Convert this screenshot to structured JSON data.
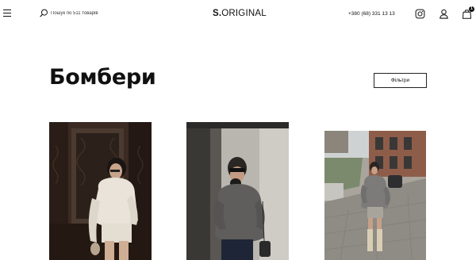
{
  "header": {
    "search": {
      "placeholder": "Пошук по 511 товарів"
    },
    "logo": {
      "bold": "S.",
      "rest": "ORIGINAL"
    },
    "phone": "+380 (68) 331 13 13",
    "cart_count": "1",
    "icons": {
      "menu": "hamburger-menu-icon",
      "search": "search-icon",
      "instagram": "instagram-icon",
      "account": "user-icon",
      "cart": "shopping-bag-icon"
    }
  },
  "catalog": {
    "title": "Бомбери",
    "filter_label": "Фільтри",
    "products": [
      {
        "photo": "model-in-cream-bomber"
      },
      {
        "photo": "model-in-grey-bomber-sunglasses"
      },
      {
        "photo": "model-in-grey-bomber-street"
      }
    ]
  }
}
